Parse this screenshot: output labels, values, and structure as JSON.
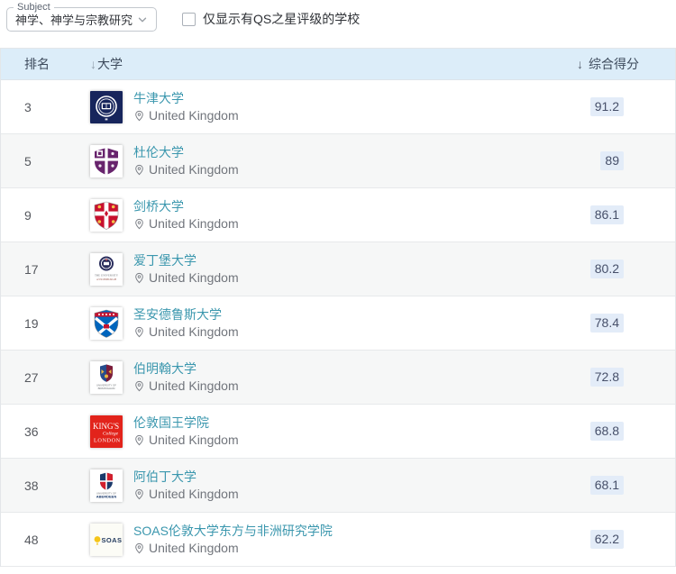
{
  "filters": {
    "subject_label": "Subject",
    "subject_value": "神学、神学与宗教研究",
    "qs_stars_label": "仅显示有QS之星评级的学校",
    "qs_stars_checked": false
  },
  "table": {
    "headers": {
      "rank": "排名",
      "university": "大学",
      "score": "综合得分",
      "sort_arrow": "↓"
    },
    "rows": [
      {
        "rank": "3",
        "name": "牛津大学",
        "country": "United Kingdom",
        "score": "91.2",
        "logo": "oxford-crest"
      },
      {
        "rank": "5",
        "name": "杜伦大学",
        "country": "United Kingdom",
        "score": "89",
        "logo": "durham-shield"
      },
      {
        "rank": "9",
        "name": "剑桥大学",
        "country": "United Kingdom",
        "score": "86.1",
        "logo": "cambridge-shield"
      },
      {
        "rank": "17",
        "name": "爱丁堡大学",
        "country": "United Kingdom",
        "score": "80.2",
        "logo": "edinburgh-crest",
        "logo_text": {
          "line1": "THE UNIVERSITY",
          "line2": "of EDINBURGH"
        }
      },
      {
        "rank": "19",
        "name": "圣安德鲁斯大学",
        "country": "United Kingdom",
        "score": "78.4",
        "logo": "st-andrews-shield"
      },
      {
        "rank": "27",
        "name": "伯明翰大学",
        "country": "United Kingdom",
        "score": "72.8",
        "logo": "birmingham-crest",
        "logo_text": {
          "line1": "UNIVERSITY OF",
          "line2": "BIRMINGHAM"
        }
      },
      {
        "rank": "36",
        "name": "伦敦国王学院",
        "country": "United Kingdom",
        "score": "68.8",
        "logo": "kings-college-london",
        "logo_text": {
          "line1": "KING'S",
          "line2": "College",
          "line3": "LONDON"
        }
      },
      {
        "rank": "38",
        "name": "阿伯丁大学",
        "country": "United Kingdom",
        "score": "68.1",
        "logo": "aberdeen-crest",
        "logo_text": {
          "line1": "UNIVERSITY OF",
          "line2": "ABERDEEN"
        }
      },
      {
        "rank": "48",
        "name": "SOAS伦敦大学东方与非洲研究学院",
        "country": "United Kingdom",
        "score": "62.2",
        "logo": "soas-logo",
        "logo_text": {
          "line1": "SOAS"
        }
      }
    ]
  },
  "colors": {
    "header_bg": "#dcedf9",
    "row_alt_bg": "#f6f7f7",
    "link_teal": "#3b97ae",
    "score_badge_bg": "#e3ecf8",
    "score_text": "#47506a",
    "oxford_navy": "#17255c",
    "durham_purple": "#68246d",
    "cambridge_red": "#c8102e",
    "st_andrews_blue": "#0065bd",
    "kcl_red": "#e2231b",
    "soas_yellow": "#f5c518"
  }
}
